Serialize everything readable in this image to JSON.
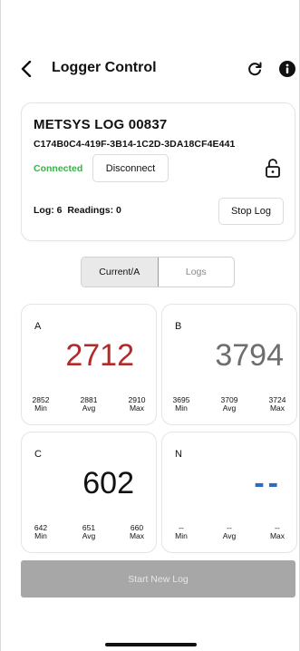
{
  "header": {
    "title": "Logger Control",
    "back_icon": "chevron-left-icon",
    "refresh_icon": "refresh-icon",
    "info_icon": "info-icon"
  },
  "device": {
    "name": "METSYS LOG 00837",
    "id": "C174B0C4-419F-3B14-1C2D-3DA18CF4E441",
    "status": "Connected",
    "status_color": "#3bb04a",
    "disconnect_label": "Disconnect",
    "lock_icon": "lock-open-icon",
    "log_info": "Log: 6  Readings: 0",
    "stop_label": "Stop Log"
  },
  "tabs": {
    "current_label": "Current/A",
    "logs_label": "Logs"
  },
  "phases": {
    "a": {
      "label": "A",
      "value": "2712",
      "value_color": "#b22a2a",
      "min": "2852",
      "avg": "2881",
      "max": "2910",
      "min_label": "Min",
      "avg_label": "Avg",
      "max_label": "Max"
    },
    "b": {
      "label": "B",
      "value": "3794",
      "value_color": "#6e6e6e",
      "min": "3695",
      "avg": "3709",
      "max": "3724",
      "min_label": "Min",
      "avg_label": "Avg",
      "max_label": "Max"
    },
    "c": {
      "label": "C",
      "value": "602",
      "value_color": "#111111",
      "min": "642",
      "avg": "651",
      "max": "660",
      "min_label": "Min",
      "avg_label": "Avg",
      "max_label": "Max"
    },
    "n": {
      "label": "N",
      "value": "--",
      "value_color": "#2d6bc0",
      "min": "--",
      "avg": "--",
      "max": "--",
      "min_label": "Min",
      "avg_label": "Avg",
      "max_label": "Max"
    }
  },
  "footer": {
    "start_label": "Start New Log"
  }
}
